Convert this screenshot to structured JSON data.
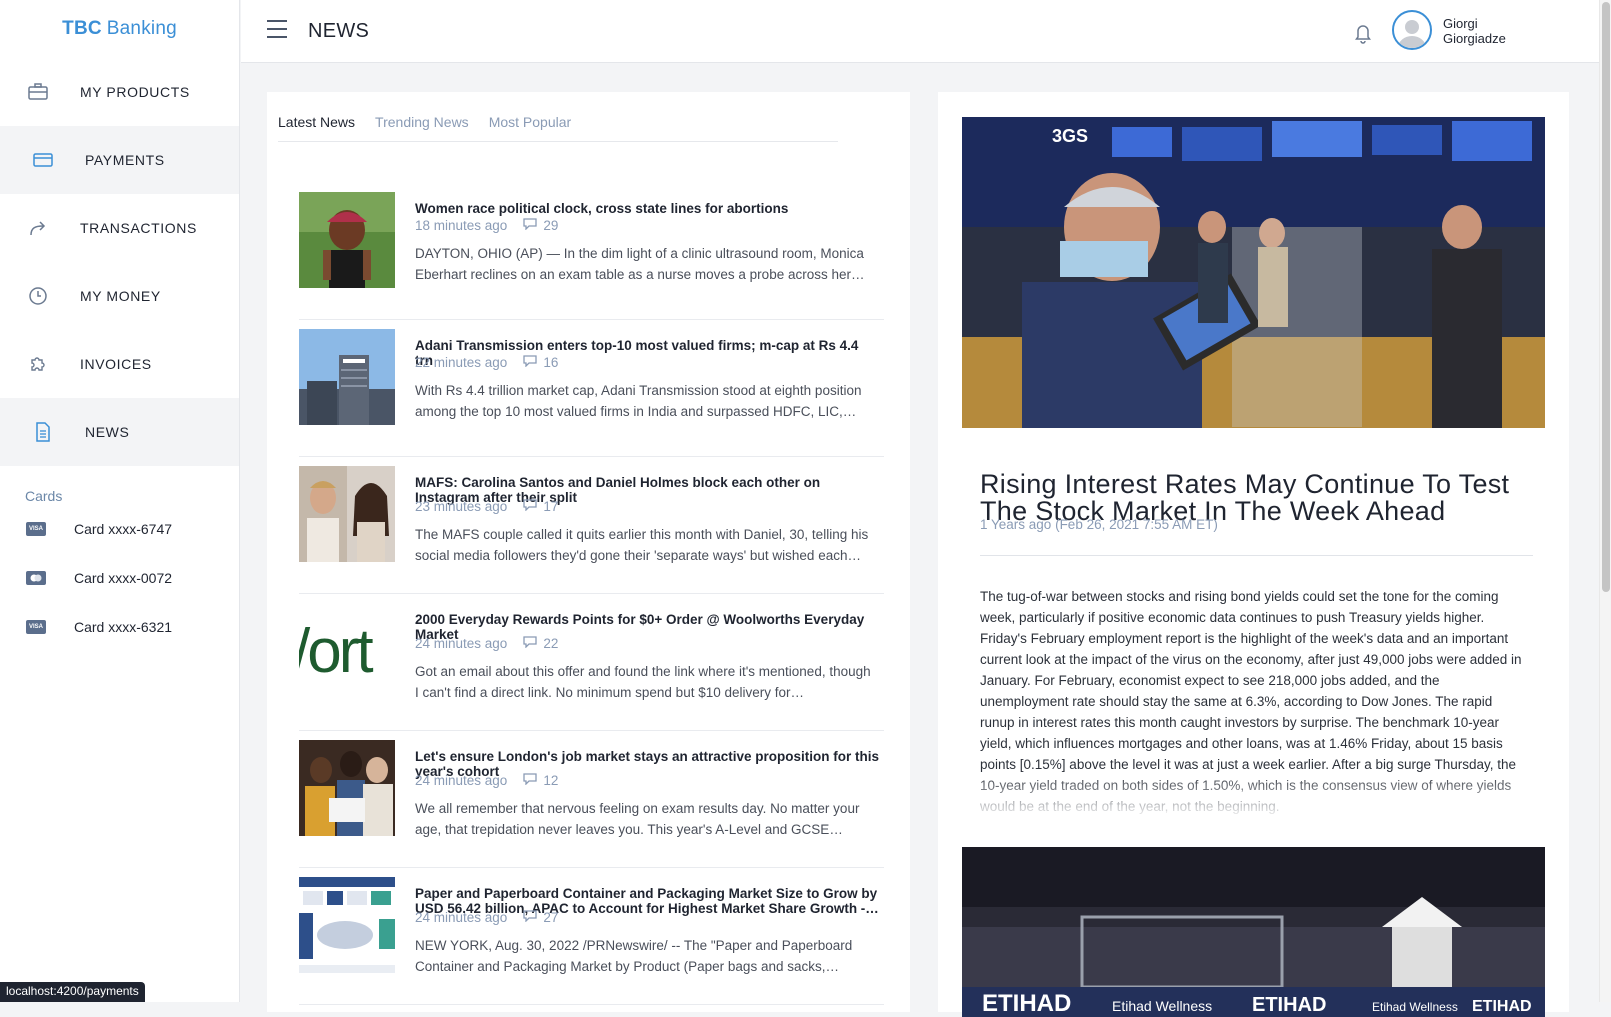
{
  "brand": {
    "bold": "TBC",
    "light": "Banking"
  },
  "nav": [
    {
      "label": "MY PRODUCTS",
      "icon": "briefcase-icon"
    },
    {
      "label": "PAYMENTS",
      "icon": "credit-card-icon"
    },
    {
      "label": "TRANSACTIONS",
      "icon": "share-arrow-icon"
    },
    {
      "label": "MY MONEY",
      "icon": "clock-icon"
    },
    {
      "label": "INVOICES",
      "icon": "puzzle-icon"
    },
    {
      "label": "NEWS",
      "icon": "document-icon"
    }
  ],
  "cards": {
    "label": "Cards",
    "items": [
      {
        "label": "Card xxxx-6747",
        "icon": "visa-card-icon",
        "brand": "VISA"
      },
      {
        "label": "Card xxxx-0072",
        "icon": "mastercard-card-icon",
        "brand": ""
      },
      {
        "label": "Card xxxx-6321",
        "icon": "visa-card-icon",
        "brand": "VISA"
      }
    ]
  },
  "header": {
    "title": "NEWS",
    "user_first": "Giorgi",
    "user_last": "Giorgiadze"
  },
  "tabs": [
    "Latest News",
    "Trending News",
    "Most Popular"
  ],
  "news": [
    {
      "title": "Women race political clock, cross state lines for abortions",
      "time": "18 minutes ago",
      "comments": "29",
      "excerpt": "DAYTON, OHIO (AP) — In the dim light of a clinic ultrasound room, Monica Eberhart reclines on an exam table as a nurse moves a probe across her…"
    },
    {
      "title": "Adani Transmission enters top-10 most valued firms; m-cap at Rs 4.4 trn",
      "time": "22 minutes ago",
      "comments": "16",
      "excerpt": "With Rs 4.4 trillion market cap, Adani Transmission stood at eighth position among the top 10 most valued firms in India and surpassed HDFC, LIC,…"
    },
    {
      "title": "MAFS: Carolina Santos and Daniel Holmes block each other on Instagram after their split",
      "time": "23 minutes ago",
      "comments": "17",
      "excerpt": "The MAFS couple called it quits earlier this month with Daniel, 30, telling his social media followers they'd gone their 'separate ways' but wished each…"
    },
    {
      "title": "2000 Everyday Rewards Points for $0+ Order @ Woolworths Everyday Market",
      "time": "24 minutes ago",
      "comments": "22",
      "excerpt": "Got an email about this offer and found the link where it's mentioned, though I can't find a direct link. No minimum spend but $10 delivery for…",
      "thumb_text": "/ort"
    },
    {
      "title": "Let's ensure London's job market stays an attractive proposition for this year's cohort",
      "time": "24 minutes ago",
      "comments": "12",
      "excerpt": "We all remember that nervous feeling on exam results day. No matter your age, that trepidation never leaves you. This year's A-Level and GCSE…"
    },
    {
      "title": "Paper and Paperboard Container and Packaging Market Size to Grow by USD 56.42 billion, APAC to Account for Highest Market Share Growth -…",
      "time": "24 minutes ago",
      "comments": "27",
      "excerpt": "NEW YORK, Aug. 30, 2022 /PRNewswire/ -- The \"Paper and Paperboard Container and Packaging Market by Product (Paper bags and sacks,…"
    }
  ],
  "article": {
    "title": "Rising Interest Rates May Continue To Test The Stock Market In The Week Ahead",
    "date": "1 Years ago (Feb 26, 2021 7:55 AM ET)",
    "body": "The tug-of-war between stocks and rising bond yields could set the tone for the coming week, particularly if positive economic data continues to push Treasury yields higher. Friday's February employment report is the highlight of the week's data and an important current look at the impact of the virus on the economy, after just 49,000 jobs were added in January. For February, economist expect to see 218,000 jobs added, and the unemployment rate should stay the same at 6.3%, according to Dow Jones. The rapid runup in interest rates this month caught investors by surprise. The benchmark 10-year yield, which influences mortgages and other loans, was at 1.46% Friday, about 15 basis points [0.15%] above the level it was at just a week earlier. After a big surge Thursday, the 10-year yield traded on both sides of 1.50%, which is the consensus view of where yields would be at the end of the year, not the beginning."
  },
  "status_url": "localhost:4200/payments",
  "colors": {
    "accent": "#3b8fd6",
    "muted": "#8a9bb5",
    "active_bg": "#f3f4f6"
  }
}
